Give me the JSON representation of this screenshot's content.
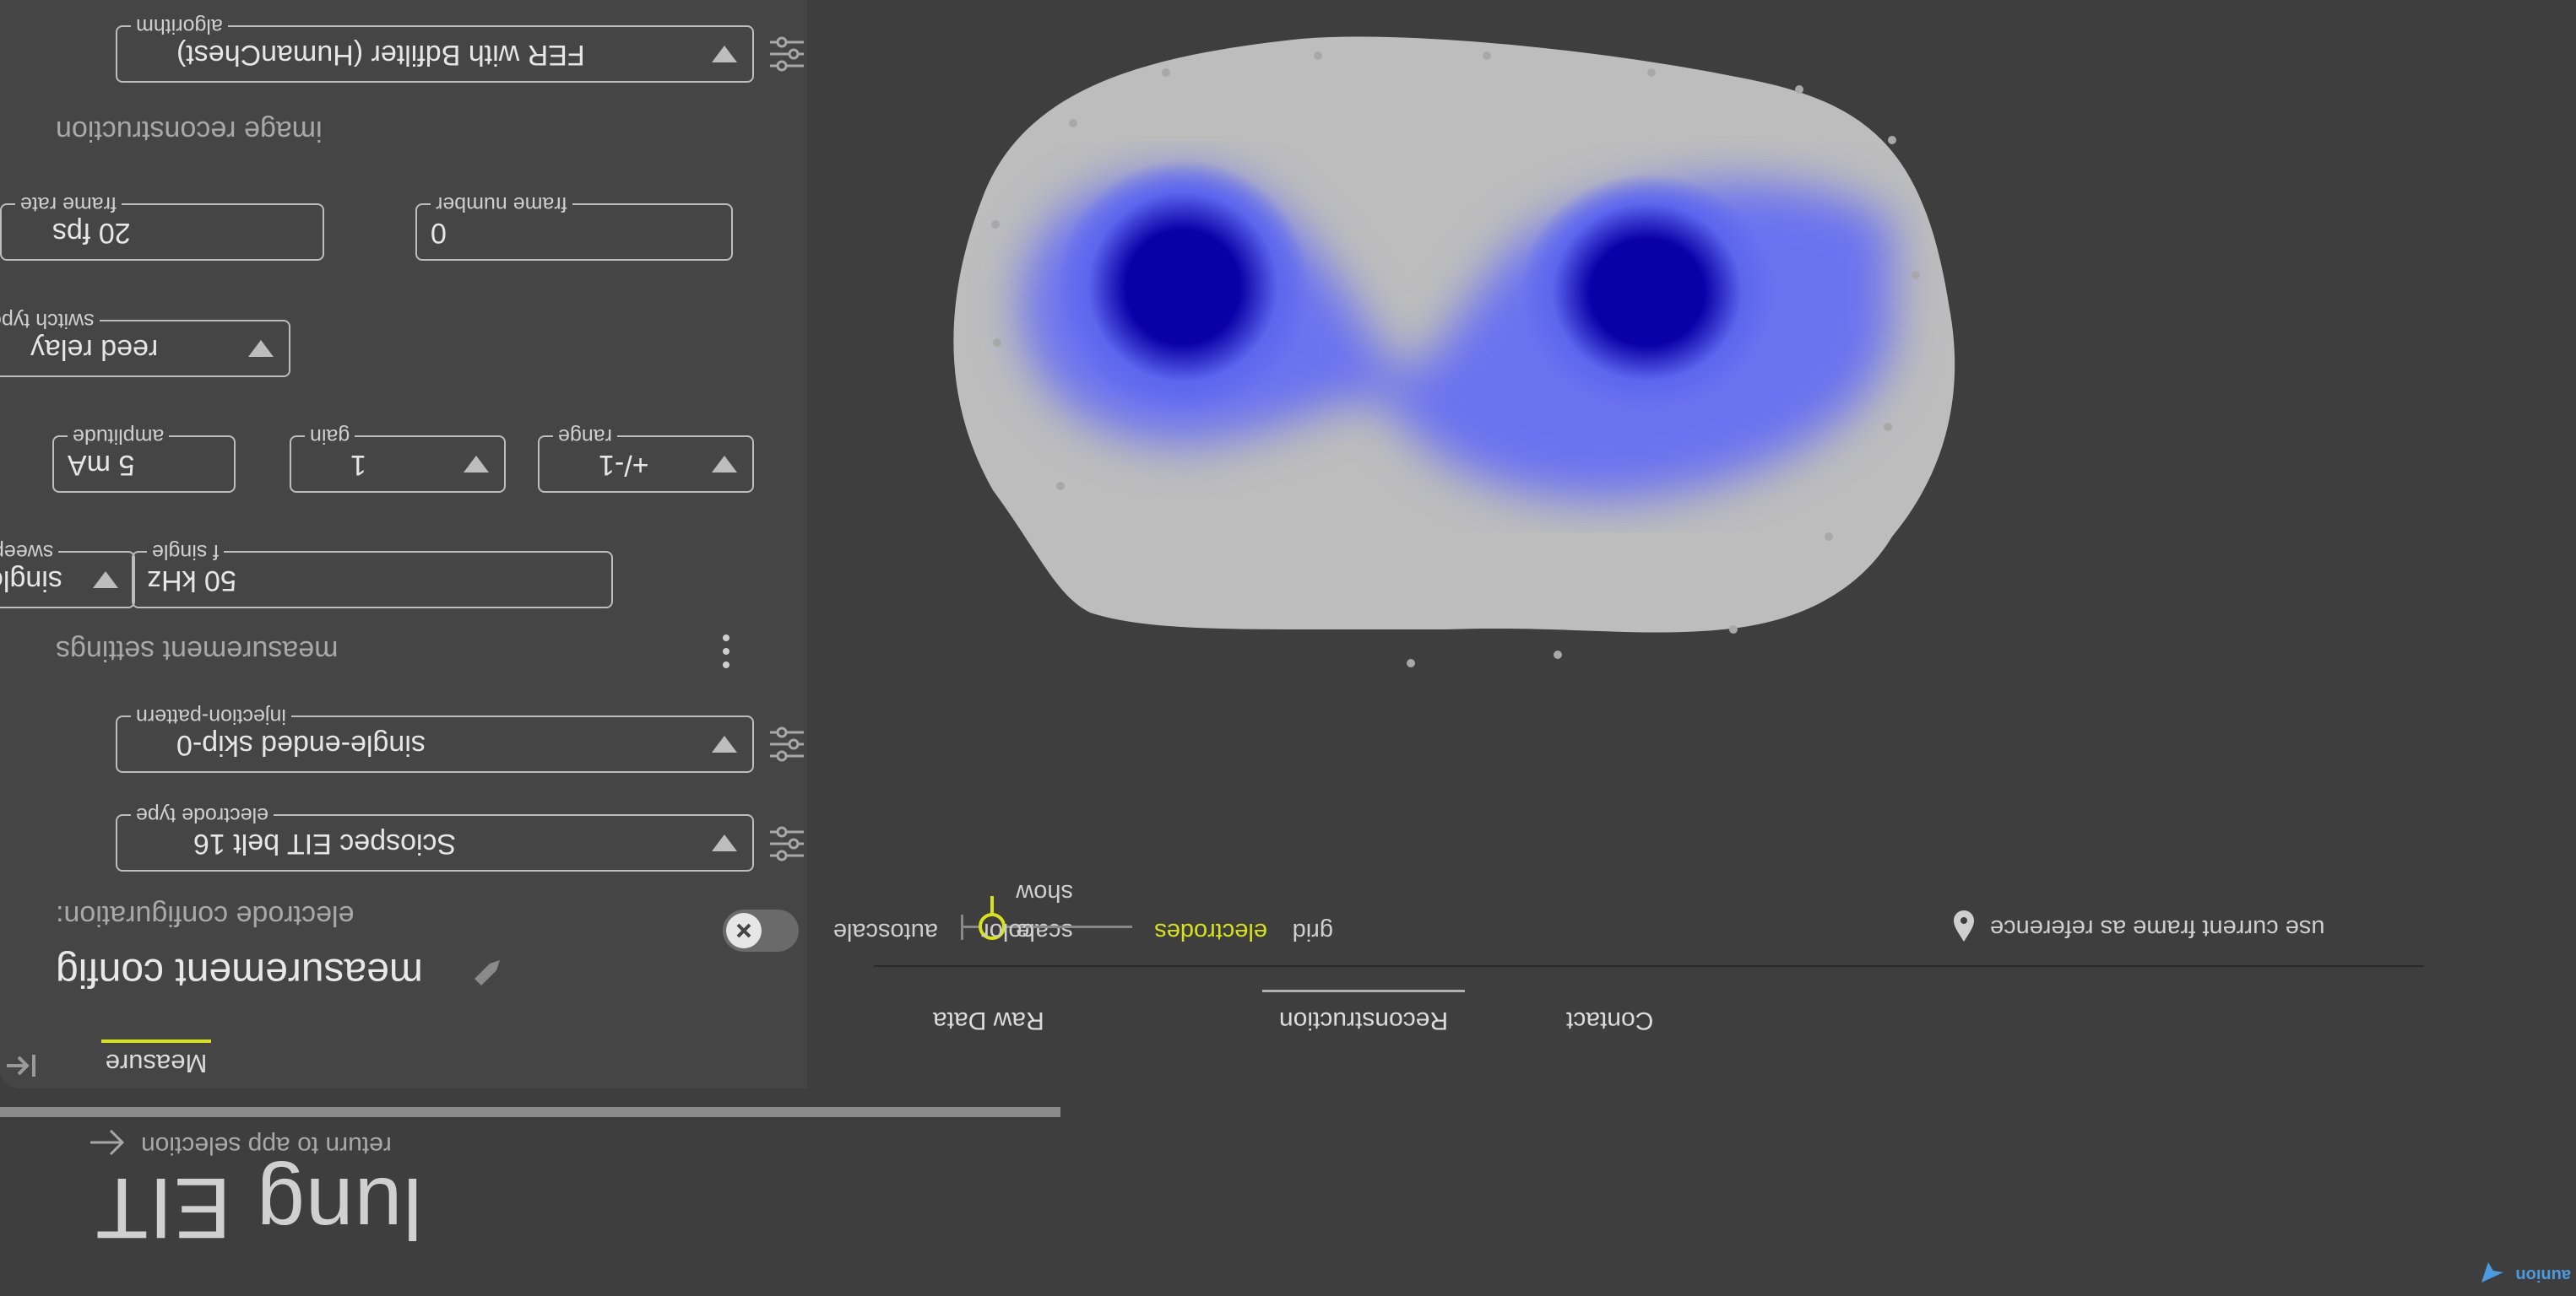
{
  "app": {
    "title": "lung EIT",
    "back_label": "return to app selection",
    "logo_text": "aunion"
  },
  "panel": {
    "tab_label": "Measure",
    "heading": "measurement config",
    "electrode_section": "electrode configuration:",
    "electrode_type": {
      "label": "electrode type",
      "value": "Sciospec EIT belt 16"
    },
    "injection_pattern": {
      "label": "injection-pattern",
      "value": "single-ended skip-0"
    },
    "measurement_section": "measurement settings",
    "sweep": {
      "label": "sweep",
      "value": "single"
    },
    "f_single": {
      "label": "f single",
      "value": "50 kHz"
    },
    "amplitude": {
      "label": "amplitude",
      "value": "5 mA"
    },
    "gain": {
      "label": "gain",
      "value": "1"
    },
    "range": {
      "label": "range",
      "value": "+/-1"
    },
    "switch_type": {
      "label": "switch type",
      "value": "reed relay"
    },
    "frame_rate": {
      "label": "frame rate",
      "value": "20 fps"
    },
    "frame_number": {
      "label": "frame number",
      "value": "0"
    },
    "reconstruction_section": "image reconstruction",
    "algorithm": {
      "label": "algorithm",
      "value": "FER with Bdfilter (HumanChest)"
    }
  },
  "view": {
    "tabs": [
      "Raw Data",
      "Reconstruction",
      "Contact"
    ],
    "active_tab": "Reconstruction",
    "autoscale_label": "autoscale",
    "autoscale_on": false,
    "color_label": "color",
    "color_slider_value": 0.17,
    "show_label": "show",
    "show_scale": "scale",
    "show_electrodes": "electrodes",
    "show_grid": "grid",
    "reference_label": "use current frame as reference"
  },
  "colors": {
    "background": "#3e3e3e",
    "panel": "#454545",
    "accent": "#d8e21a",
    "image_blue": "#0a00a8",
    "image_grey": "#bdbdbd"
  },
  "icons": [
    "back-arrow-icon",
    "edit-pencil-icon",
    "tune-icon",
    "more-vert-icon",
    "close-icon",
    "drop-icon",
    "collapse-panel-icon",
    "logo-icon"
  ]
}
